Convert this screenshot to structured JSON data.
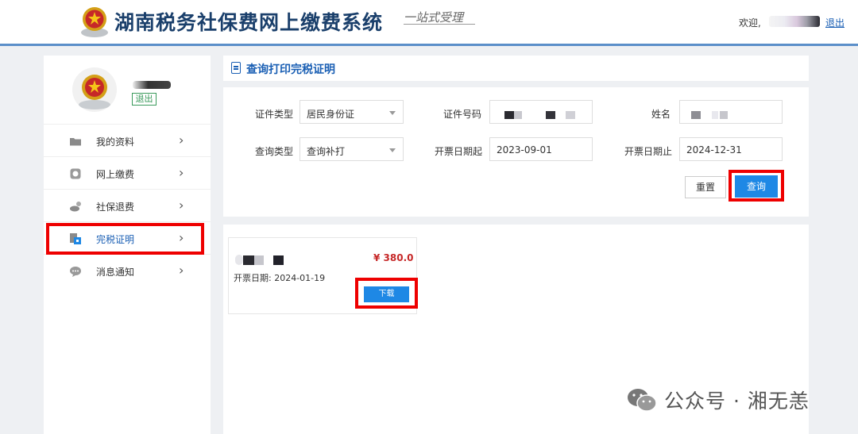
{
  "header": {
    "site_title": "湖南税务社保费网上缴费系统",
    "slogan": "一站式受理",
    "welcome": "欢迎,",
    "logout": "退出"
  },
  "sidebar": {
    "logout": "退出",
    "items": [
      {
        "label": "我的资料",
        "icon": "folder-icon"
      },
      {
        "label": "网上缴费",
        "icon": "payment-icon"
      },
      {
        "label": "社保退费",
        "icon": "refund-icon"
      },
      {
        "label": "完税证明",
        "icon": "certificate-icon"
      },
      {
        "label": "消息通知",
        "icon": "message-icon"
      }
    ],
    "active_index": 3
  },
  "section": {
    "title": "查询打印完税证明"
  },
  "form": {
    "id_type_label": "证件类型",
    "id_type_value": "居民身份证",
    "id_number_label": "证件号码",
    "name_label": "姓名",
    "query_type_label": "查询类型",
    "query_type_value": "查询补打",
    "start_date_label": "开票日期起",
    "start_date_value": "2023-09-01",
    "end_date_label": "开票日期止",
    "end_date_value": "2024-12-31",
    "reset_label": "重置",
    "query_label": "查询"
  },
  "result": {
    "amount": "¥ 380.0",
    "issue_date": "开票日期: 2024-01-19",
    "download_label": "下载"
  },
  "watermark": {
    "text": "公众号 · 湘无恙"
  },
  "colors": {
    "accent": "#1e88e5",
    "title": "#1a5fb4",
    "highlight": "#e00000",
    "amount": "#c62828"
  }
}
